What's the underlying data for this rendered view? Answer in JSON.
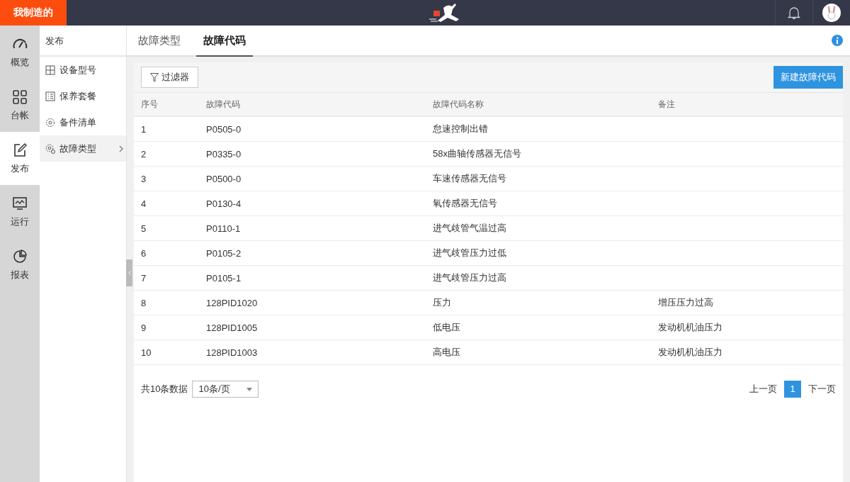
{
  "brand": "我制造的",
  "rail": [
    {
      "label": "概览",
      "selected": false
    },
    {
      "label": "台帐",
      "selected": false
    },
    {
      "label": "发布",
      "selected": true
    },
    {
      "label": "运行",
      "selected": false
    },
    {
      "label": "报表",
      "selected": false
    }
  ],
  "submenu": {
    "title": "发布",
    "items": [
      {
        "label": "设备型号",
        "selected": false
      },
      {
        "label": "保养套餐",
        "selected": false
      },
      {
        "label": "备件清单",
        "selected": false
      },
      {
        "label": "故障类型",
        "selected": true
      }
    ]
  },
  "tabs": [
    {
      "label": "故障类型",
      "selected": false
    },
    {
      "label": "故障代码",
      "selected": true
    }
  ],
  "toolbar": {
    "filter": "过滤器",
    "new_button": "新建故障代码"
  },
  "table": {
    "columns": [
      "序号",
      "故障代码",
      "故障代码名称",
      "备注"
    ],
    "rows": [
      [
        "1",
        "P0505-0",
        "怠速控制出错",
        ""
      ],
      [
        "2",
        "P0335-0",
        "58x曲轴传感器无信号",
        ""
      ],
      [
        "3",
        "P0500-0",
        "车速传感器无信号",
        ""
      ],
      [
        "4",
        "P0130-4",
        "氧传感器无信号",
        ""
      ],
      [
        "5",
        "P0110-1",
        "进气歧管气温过高",
        ""
      ],
      [
        "6",
        "P0105-2",
        "进气歧管压力过低",
        ""
      ],
      [
        "7",
        "P0105-1",
        "进气歧管压力过高",
        ""
      ],
      [
        "8",
        "128PID1020",
        "压力",
        "增压压力过高"
      ],
      [
        "9",
        "128PID1005",
        "低电压",
        "发动机机油压力"
      ],
      [
        "10",
        "128PID1003",
        "高电压",
        "发动机机油压力"
      ]
    ]
  },
  "footer": {
    "total": "共10条数据",
    "page_size": "10条/页",
    "prev": "上一页",
    "pages": [
      {
        "label": "1",
        "selected": true
      }
    ],
    "next": "下一页"
  }
}
